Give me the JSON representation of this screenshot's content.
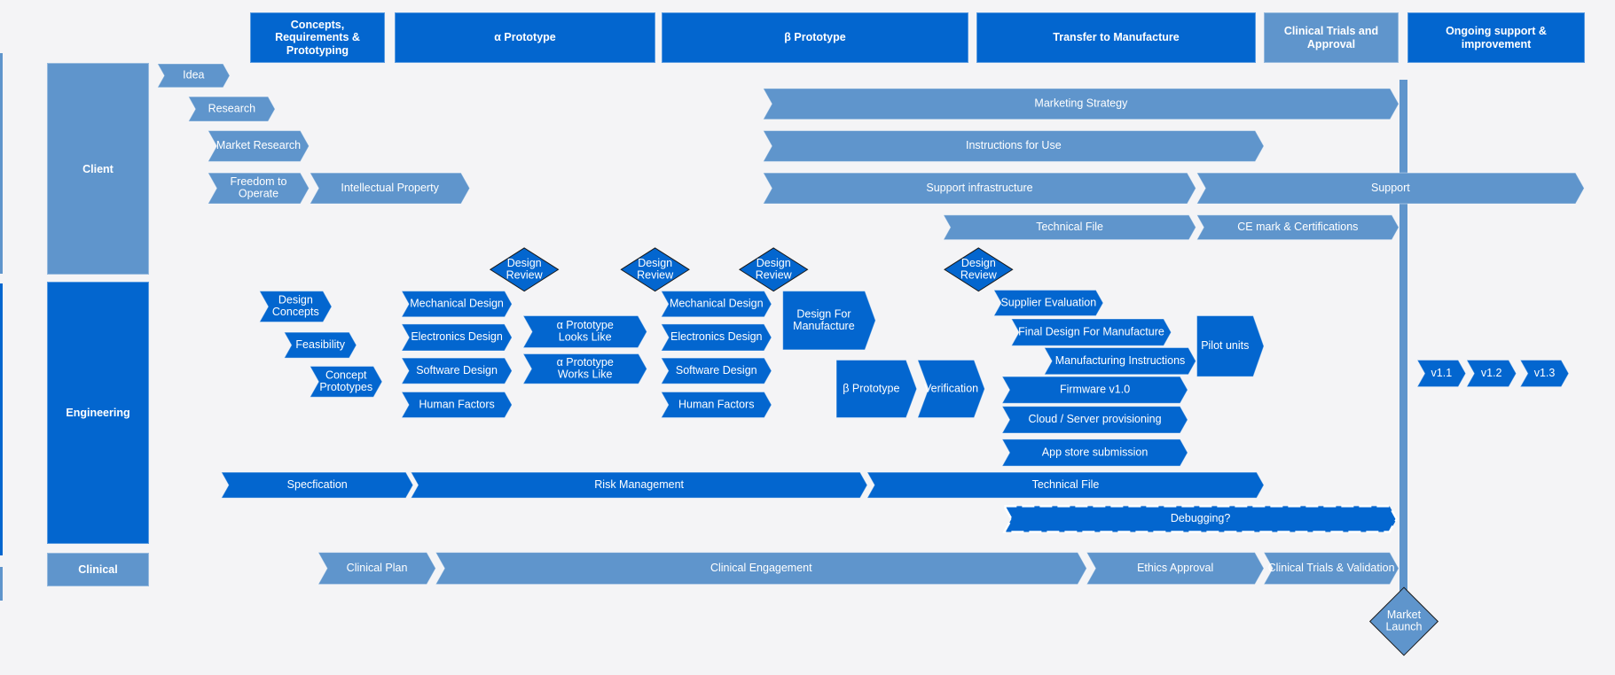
{
  "colors": {
    "primary": "#0366cf",
    "secondary": "#5f95cc",
    "background": "#f4f4f6",
    "outline": "#1b1b1b"
  },
  "phases": [
    {
      "label": "Concepts, Requirements & Prototyping",
      "style": "dark"
    },
    {
      "label": "α Prototype",
      "style": "dark"
    },
    {
      "label": "β Prototype",
      "style": "dark"
    },
    {
      "label": "Transfer to Manufacture",
      "style": "dark"
    },
    {
      "label": "Clinical Trials and Approval",
      "style": "light"
    },
    {
      "label": "Ongoing support & improvement",
      "style": "dark"
    }
  ],
  "lanes": [
    {
      "label": "Client",
      "style": "light"
    },
    {
      "label": "Engineering",
      "style": "dark"
    },
    {
      "label": "Clinical",
      "style": "light"
    }
  ],
  "client_tasks": [
    "Idea",
    "Research",
    "Market Research",
    "Freedom to Operate",
    "Intellectual Property",
    "Marketing Strategy",
    "Instructions for Use",
    "Support infrastructure",
    "Support",
    "Technical File",
    "CE mark & Certifications"
  ],
  "engineering_tasks": [
    "Design Concepts",
    "Feasibility",
    "Concept Prototypes",
    "Mechanical Design",
    "Electronics Design",
    "Software Design",
    "Human Factors",
    "α Prototype Looks Like",
    "α Prototype Works Like",
    "Mechanical Design",
    "Electronics Design",
    "Software Design",
    "Human Factors",
    "Design For Manufacture",
    "β Prototype",
    "Verification",
    "Supplier Evaluation",
    "Final Design For Manufacture",
    "Manufacturing Instructions",
    "Firmware v1.0",
    "Cloud / Server provisioning",
    "App store submission",
    "Pilot units",
    "v1.1",
    "v1.2",
    "v1.3",
    "Specfication",
    "Risk Management",
    "Technical File",
    "Debugging?"
  ],
  "clinical_tasks": [
    "Clinical Plan",
    "Clinical Engagement",
    "Ethics Approval",
    "Clinical Trials & Validation"
  ],
  "milestones": [
    "Design Review",
    "Design Review",
    "Design Review",
    "Design Review",
    "Market Launch"
  ]
}
